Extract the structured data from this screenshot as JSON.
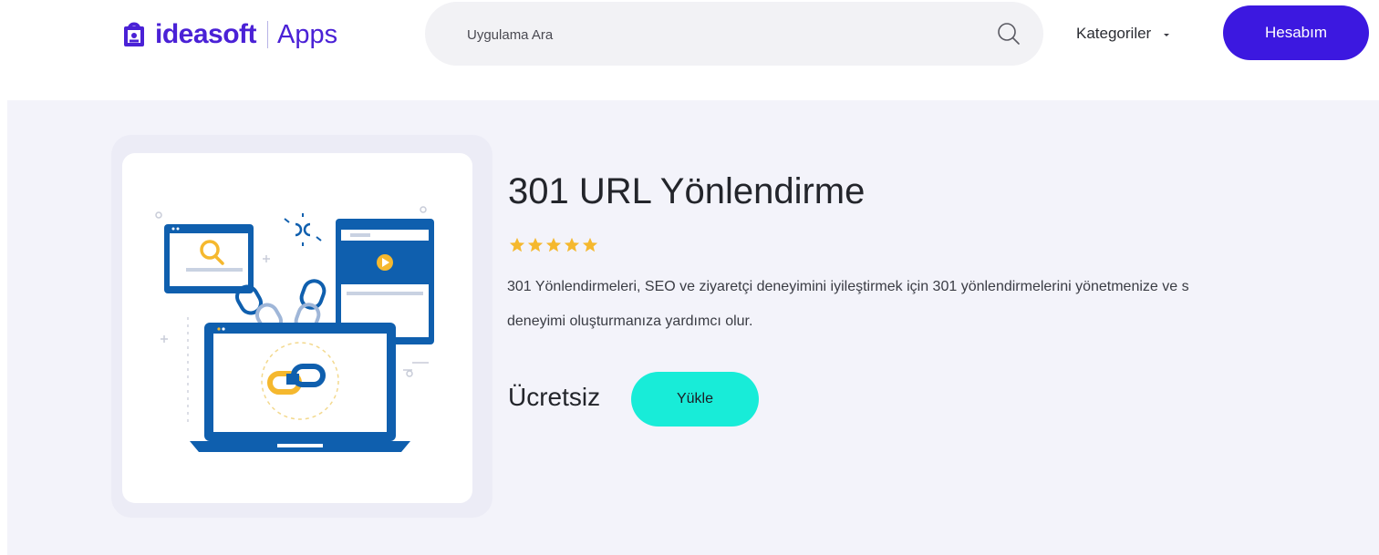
{
  "header": {
    "logo_name": "ideasoft",
    "logo_suffix": "Apps",
    "search_placeholder": "Uygulama Ara",
    "search_icon": "search-icon",
    "categories_label": "Kategoriler",
    "account_button": "Hesabım"
  },
  "product": {
    "title": "301 URL Yönlendirme",
    "rating": 5,
    "rating_max": 5,
    "description_line1": "301 Yönlendirmeleri, SEO ve ziyaretçi deneyimini iyileştirmek için 301 yönlendirmelerini yönetmenize ve s",
    "description_line2": "deneyimi oluşturmanıza yardımcı olur.",
    "price": "Ücretsiz",
    "install_button": "Yükle"
  },
  "colors": {
    "brand_purple": "#4a21d6",
    "account_button_bg": "#3c18e0",
    "install_button_bg": "#18ecd8",
    "star": "#f5b82e",
    "page_bg": "#f3f3fa"
  }
}
